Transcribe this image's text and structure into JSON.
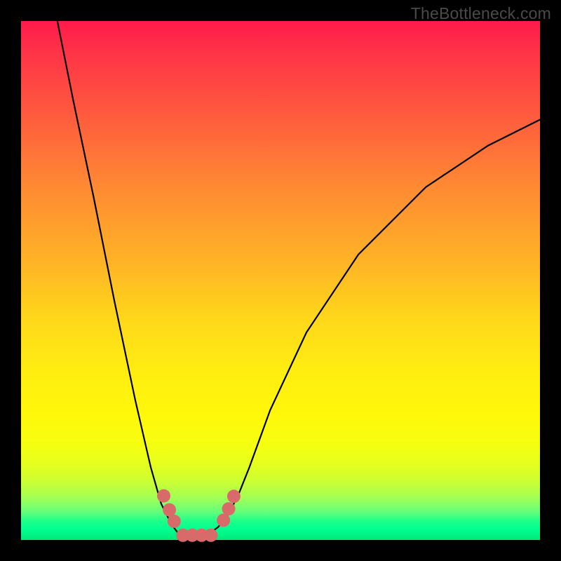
{
  "watermark": "TheBottleneck.com",
  "chart_data": {
    "type": "line",
    "title": "",
    "xlabel": "",
    "ylabel": "",
    "xlim": [
      0,
      100
    ],
    "ylim": [
      0,
      100
    ],
    "grid": false,
    "series": [
      {
        "name": "bottleneck-curve",
        "x": [
          7,
          10,
          14,
          18,
          22,
          25,
          27,
          29,
          30.5,
          31.5,
          32.5,
          34,
          36,
          38,
          40,
          42,
          44,
          48,
          55,
          65,
          78,
          90,
          100
        ],
        "y": [
          100,
          85,
          66,
          46,
          27,
          14,
          7,
          3,
          1,
          0,
          0,
          0,
          1,
          2.5,
          5,
          9,
          14,
          25,
          40,
          55,
          68,
          76,
          81
        ]
      }
    ],
    "markers": [
      {
        "x": 27.5,
        "y": 8.5
      },
      {
        "x": 28.6,
        "y": 5.8
      },
      {
        "x": 29.5,
        "y": 3.6
      },
      {
        "x": 31.2,
        "y": 0.9
      },
      {
        "x": 33.0,
        "y": 0.9
      },
      {
        "x": 34.8,
        "y": 0.9
      },
      {
        "x": 36.6,
        "y": 0.9
      },
      {
        "x": 39.0,
        "y": 3.8
      },
      {
        "x": 40.0,
        "y": 6.0
      },
      {
        "x": 41.0,
        "y": 8.4
      }
    ],
    "background_gradient": {
      "top": "#ff1a4a",
      "middle": "#ffe615",
      "bottom": "#00e87a"
    }
  }
}
